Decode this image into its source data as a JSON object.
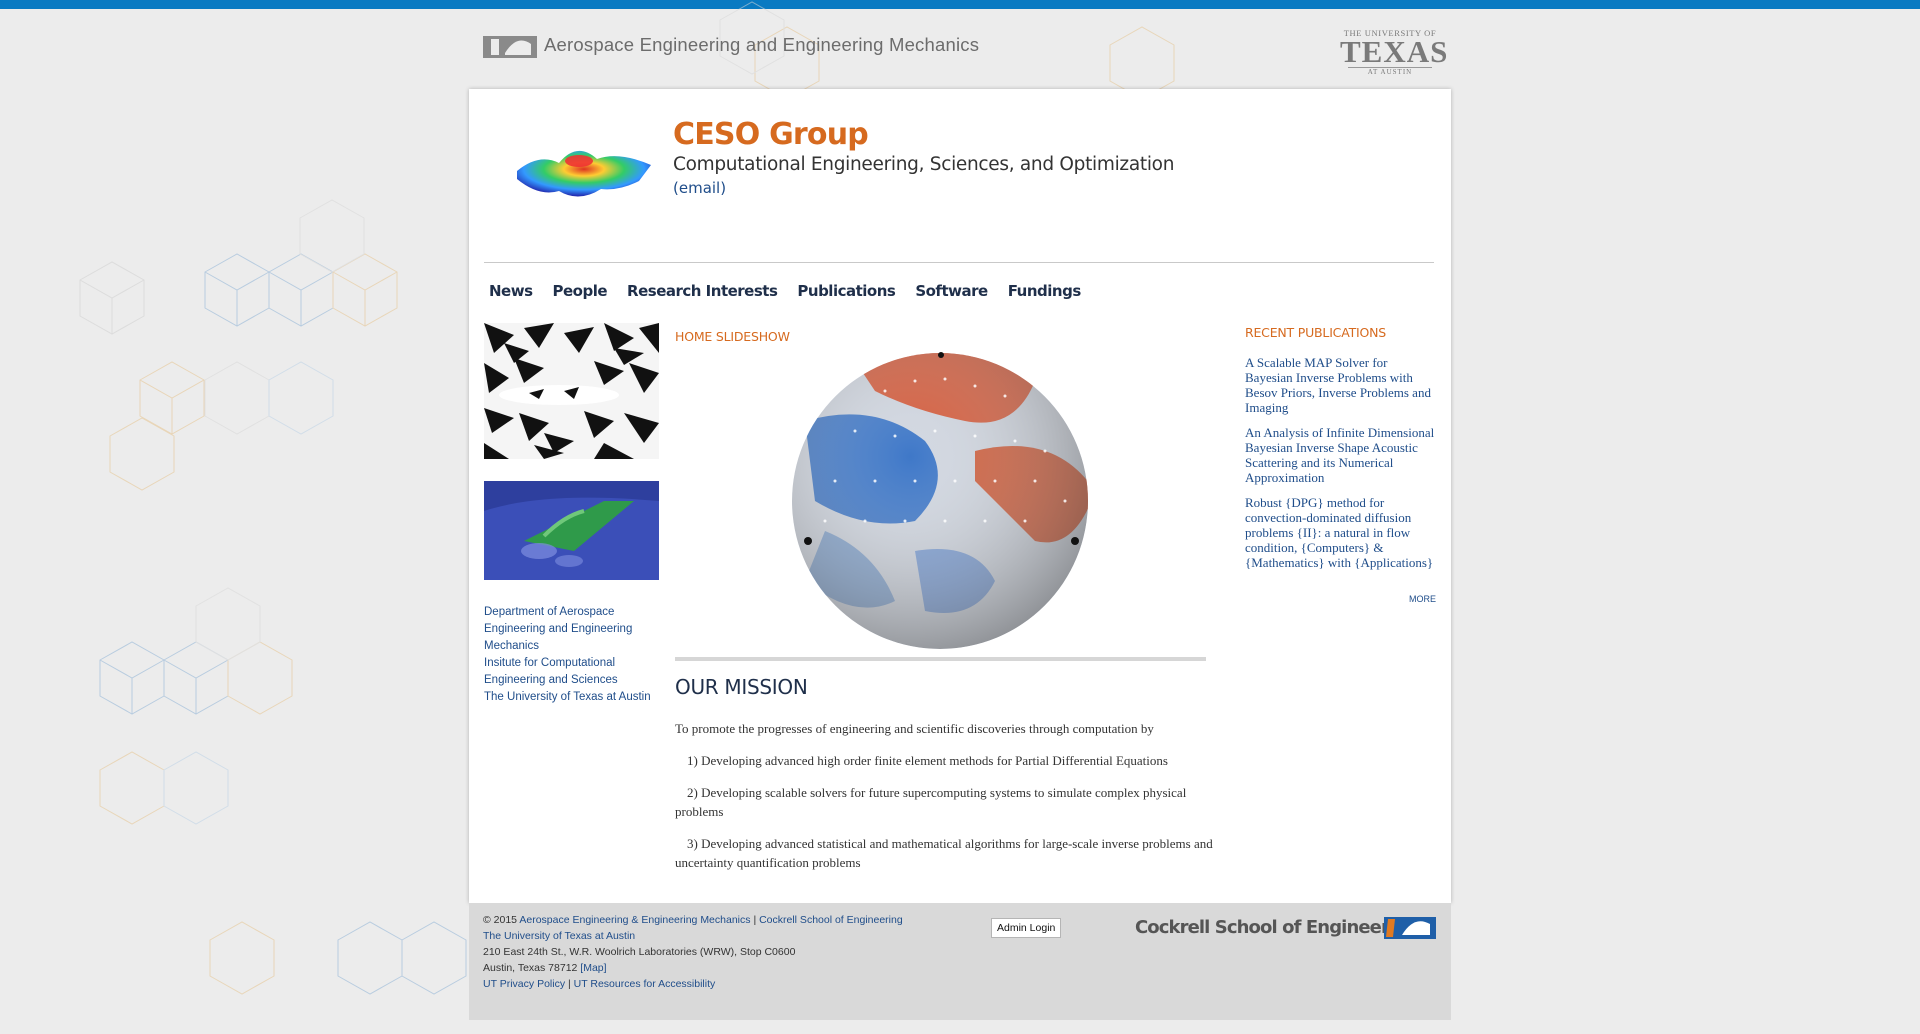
{
  "site": {
    "department_name": "Aerospace Engineering and Engineering Mechanics",
    "ut_logo": {
      "line1": "THE UNIVERSITY OF",
      "line2": "TEXAS",
      "line3": "AT AUSTIN"
    },
    "group_title": "CESO Group",
    "group_subtitle": "Computational Engineering, Sciences, and Optimization",
    "email_link": "(email)"
  },
  "nav": [
    {
      "label": "News"
    },
    {
      "label": "People"
    },
    {
      "label": "Research Interests"
    },
    {
      "label": "Publications"
    },
    {
      "label": "Software"
    },
    {
      "label": "Fundings"
    }
  ],
  "sidebar": {
    "links": [
      "Department of Aerospace Engineering and Engineering Mechanics",
      "Insitute for Computational Engineering and Sciences",
      "The University of Texas at Austin"
    ]
  },
  "slideshow": {
    "label": "HOME SLIDESHOW"
  },
  "mission": {
    "title": "OUR MISSION",
    "intro": "To promote the progresses of engineering and scientific discoveries through computation by",
    "items": [
      "1) Developing advanced  high order finite element methods for Partial Differential Equations",
      "2) Developing scalable solvers for future supercomputing systems to simulate complex physical problems",
      "3) Developing advanced statistical and mathematical  algorithms for large-scale inverse problems and uncertainty quantification problems"
    ]
  },
  "recent_publications": {
    "title": "RECENT PUBLICATIONS",
    "items": [
      "A Scalable MAP Solver for Bayesian Inverse Problems with Besov Priors, Inverse Problems and Imaging",
      "An Analysis of Infinite Dimensional Bayesian Inverse Shape Acoustic Scattering and its Numerical Approximation",
      "Robust {DPG} method for convection-dominated diffusion problems {II}: a natural in flow condition, {Computers} & {Mathematics} with {Applications}"
    ],
    "more": "MORE"
  },
  "footer": {
    "copyright": "© 2015",
    "dept_link": "Aerospace Engineering & Engineering Mechanics",
    "sep": "|",
    "school_link": "Cockrell School of Engineering",
    "ut_link": "The University of Texas at Austin",
    "address1": "210 East 24th St., W.R. Woolrich Laboratories (WRW), Stop C0600",
    "address2": "Austin, Texas 78712",
    "map_link": "[Map]",
    "privacy_link": "UT Privacy Policy",
    "access_link": "UT Resources for Accessibility",
    "admin_login": "Admin Login",
    "cockrell_brand": "Cockrell School of Engineering"
  },
  "colors": {
    "accent_orange": "#d66a1f",
    "link_blue": "#1f4d8a",
    "top_bar": "#0a7ac2"
  }
}
